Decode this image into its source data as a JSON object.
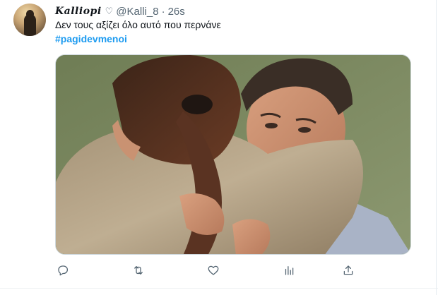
{
  "tweet": {
    "author_name": "𝑲𝒂𝒍𝒍𝒊𝒐𝒑𝒊",
    "author_heart": "♡",
    "handle": "@Kalli_8",
    "separator": "·",
    "time": "26s",
    "text": "Δεν τους αξίζει όλο αυτό που περνάνε",
    "hashtag": "#pagidevmenoi"
  },
  "media": {
    "description_icon": "photo"
  },
  "actions": [
    {
      "icon": "reply-icon"
    },
    {
      "icon": "retweet-icon"
    },
    {
      "icon": "like-icon"
    },
    {
      "icon": "analytics-icon"
    },
    {
      "icon": "share-icon"
    }
  ],
  "colors": {
    "link": "#1d9bf0",
    "muted": "#536471",
    "text": "#0f1419"
  }
}
